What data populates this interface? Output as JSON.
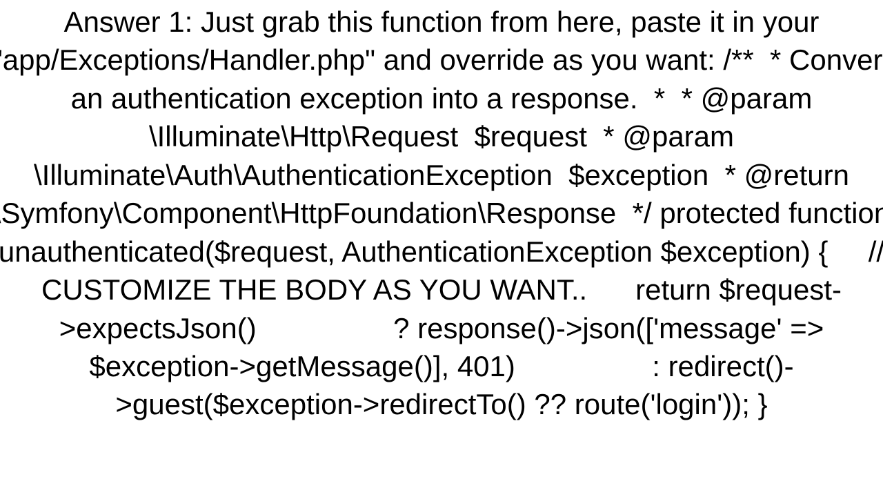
{
  "answer": {
    "label": "Answer 1:",
    "intro": "Just grab this function from here, paste it in your \"app/Exceptions/Handler.php\" and override as you want:",
    "code": "/**  * Convert an authentication exception into a response.  *  * @param  \\Illuminate\\Http\\Request  $request  * @param  \\Illuminate\\Auth\\AuthenticationException  $exception  * @return \\Symfony\\Component\\HttpFoundation\\Response  */ protected function unauthenticated($request, AuthenticationException $exception) {     // CUSTOMIZE THE BODY AS YOU WANT..      return $request->expectsJson()                 ? response()->json(['message' => $exception->getMessage()], 401)                 : redirect()->guest($exception->redirectTo() ?? route('login')); }",
    "full_text": "Answer 1: Just grab this function from here, paste it in your \"app/Exceptions/Handler.php\" and override as you want: /**  * Convert an authentication exception into a response.  *  * @param  \\Illuminate\\Http\\Request  $request  * @param  \\Illuminate\\Auth\\AuthenticationException  $exception  * @return \\Symfony\\Component\\HttpFoundation\\Response  */ protected function unauthenticated($request, AuthenticationException $exception) {     // CUSTOMIZE THE BODY AS YOU WANT..      return $request->expectsJson()                 ? response()->json(['message' => $exception->getMessage()], 401)                 : redirect()->guest($exception->redirectTo() ?? route('login')); }"
  }
}
